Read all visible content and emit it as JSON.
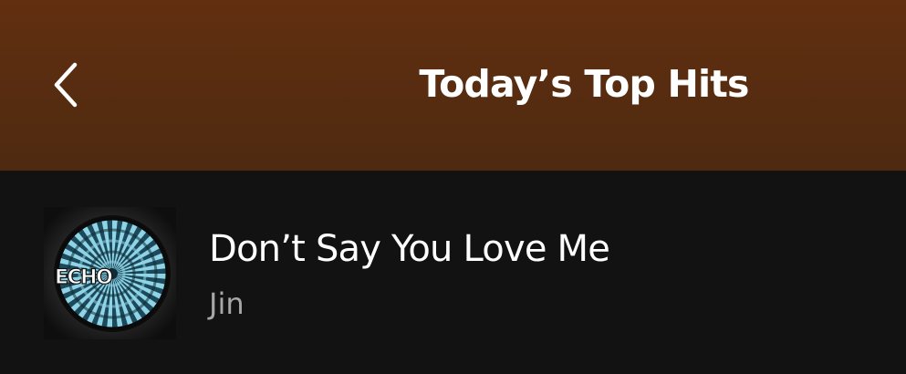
{
  "header": {
    "title": "Today’s Top Hits",
    "back_icon": "chevron-left-icon",
    "background_color": "#5a2d10"
  },
  "track": {
    "title": "Don’t Say You Love Me",
    "artist": "Jin",
    "album_art_label": "ECHO",
    "album_art_colors": {
      "ring_light": "#8fd3e6",
      "ring_dark": "#1d4a5a",
      "background": "#1b1b1b"
    }
  },
  "colors": {
    "background": "#121212",
    "primary_text": "#ffffff",
    "secondary_text": "#a7a7a7"
  }
}
